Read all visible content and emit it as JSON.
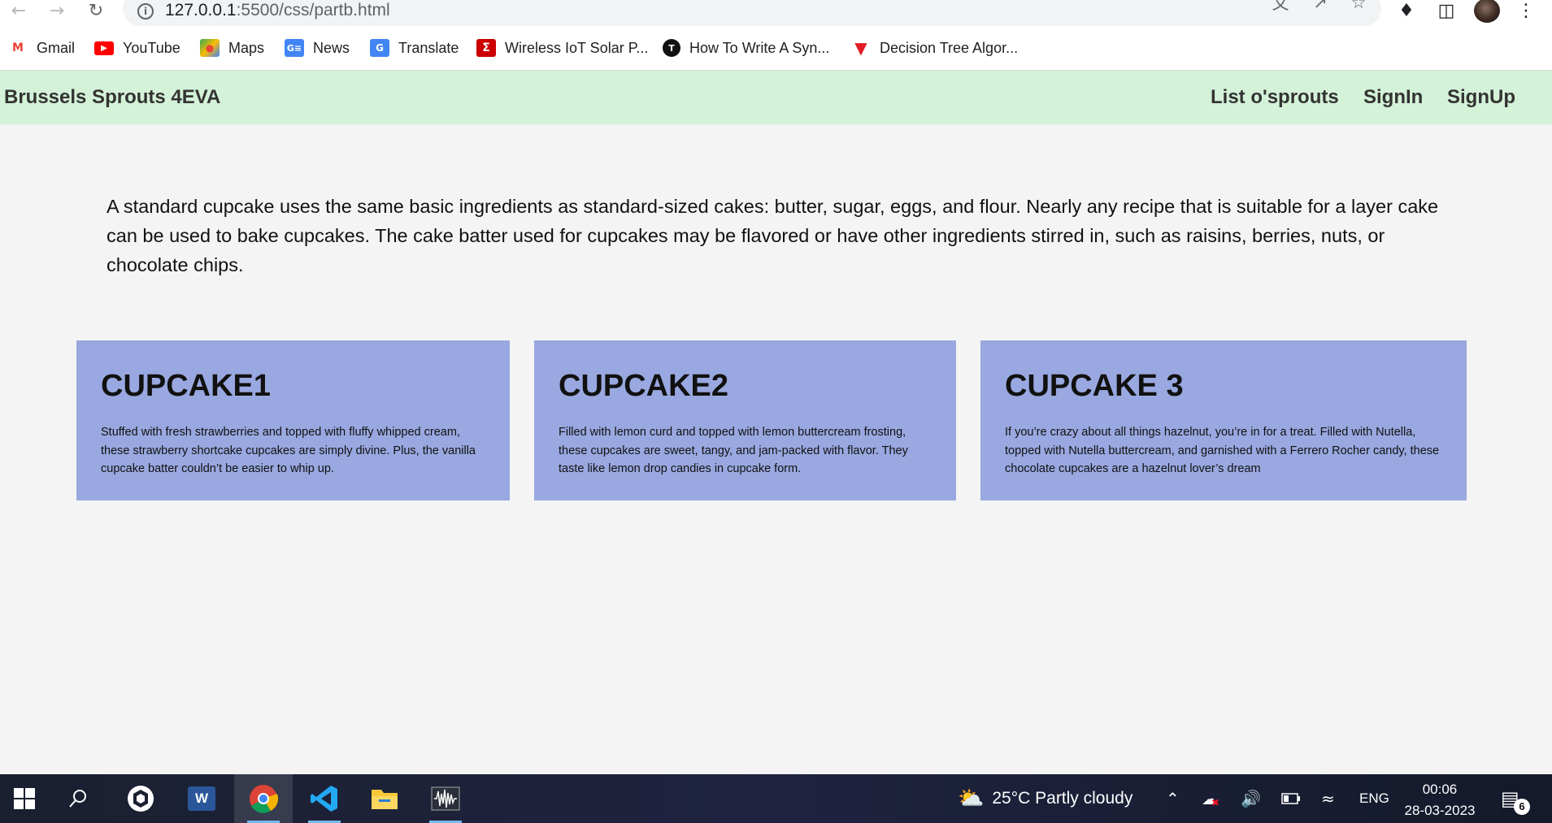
{
  "browser": {
    "url_host": "127.0.0.1",
    "url_rest": ":5500/css/partb.html",
    "bookmarks": [
      {
        "label": "Gmail",
        "icon": "gmail-icon"
      },
      {
        "label": "YouTube",
        "icon": "youtube-icon"
      },
      {
        "label": "Maps",
        "icon": "maps-icon"
      },
      {
        "label": "News",
        "icon": "news-icon"
      },
      {
        "label": "Translate",
        "icon": "translate-icon"
      },
      {
        "label": "Wireless IoT Solar P...",
        "icon": "sigma-icon"
      },
      {
        "label": "How To Write A Syn...",
        "icon": "circle-t-icon"
      },
      {
        "label": "Decision Tree Algor...",
        "icon": "red-t-icon"
      }
    ]
  },
  "site": {
    "brand": "Brussels Sprouts 4EVA",
    "nav": [
      "List o'sprouts",
      "SignIn",
      "SignUp"
    ],
    "intro": "A standard cupcake uses the same basic ingredients as standard-sized cakes: butter, sugar, eggs, and flour. Nearly any recipe that is suitable for a layer cake can be used to bake cupcakes. The cake batter used for cupcakes may be flavored or have other ingredients stirred in, such as raisins, berries, nuts, or chocolate chips.",
    "cards": [
      {
        "title": "CUPCAKE1",
        "text": "Stuffed with fresh strawberries and topped with fluffy whipped cream, these strawberry shortcake cupcakes are simply divine. Plus, the vanilla cupcake batter couldn’t be easier to whip up."
      },
      {
        "title": "CUPCAKE2",
        "text": "Filled with lemon curd and topped with lemon buttercream frosting, these cupcakes are sweet, tangy, and jam-packed with flavor. They taste like lemon drop candies in cupcake form."
      },
      {
        "title": "CUPCAKE 3",
        "text": "If you’re crazy about all things hazelnut, you’re in for a treat. Filled with Nutella, topped with Nutella buttercream, and garnished with a Ferrero Rocher candy, these chocolate cupcakes are a hazelnut lover’s dream"
      }
    ],
    "colors": {
      "nav_bg": "#d4f2d8",
      "card_bg": "#99a8e0",
      "page_bg": "#f4f4f4"
    }
  },
  "taskbar": {
    "weather": "25°C  Partly cloudy",
    "language": "ENG",
    "time": "00:06",
    "date": "28-03-2023",
    "notifications": "6"
  }
}
